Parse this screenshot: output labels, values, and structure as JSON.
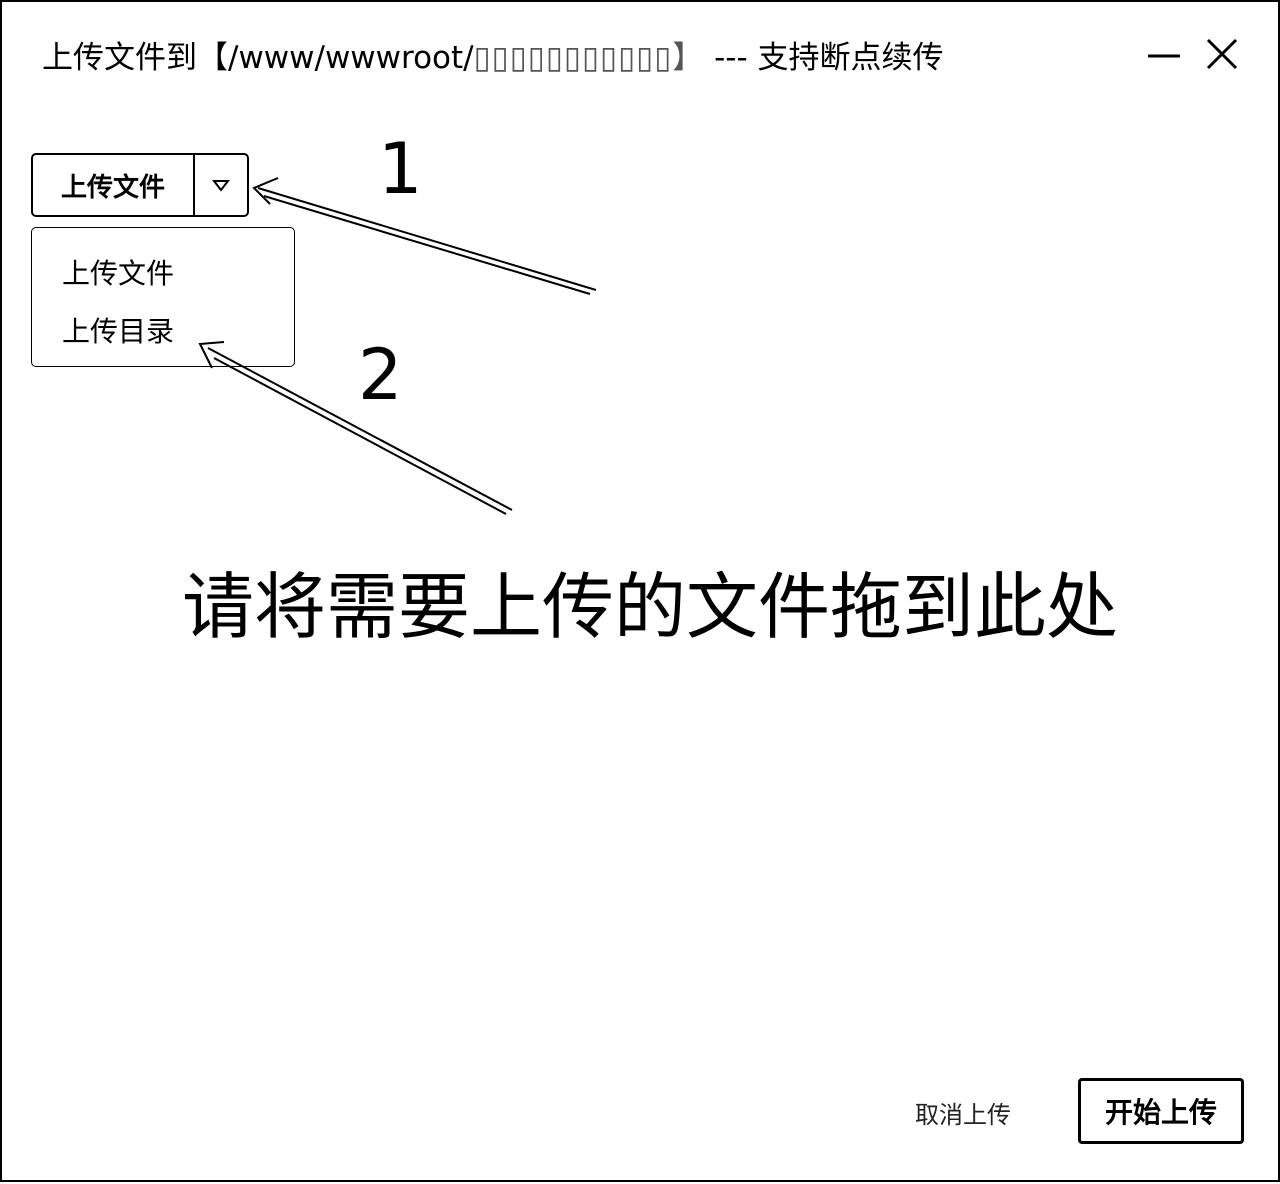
{
  "window": {
    "title": "上传文件到【/www/wwwroot/",
    "title_redacted": "▯▯▯▯▯▯▯▯▯▯▯】",
    "title_suffix": " --- 支持断点续传"
  },
  "toolbar": {
    "upload_button_label": "上传文件",
    "dropdown_icon": "caret-down-icon"
  },
  "dropdown_menu": {
    "items": [
      {
        "label": "上传文件"
      },
      {
        "label": "上传目录"
      }
    ]
  },
  "annotations": {
    "callout_1": "1",
    "callout_2": "2"
  },
  "dropzone": {
    "hint": "请将需要上传的文件拖到此处"
  },
  "footer": {
    "cancel_label": "取消上传",
    "start_label": "开始上传"
  }
}
